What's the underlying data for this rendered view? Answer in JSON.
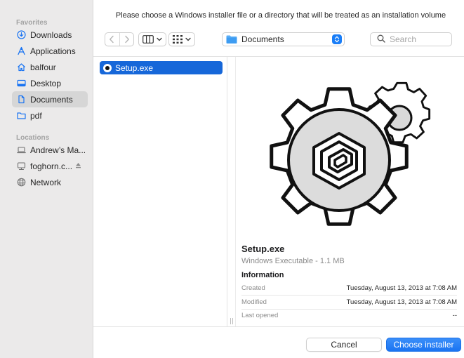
{
  "dialog": {
    "prompt": "Please choose a Windows installer file or a directory that will be treated as an installation volume"
  },
  "sidebar": {
    "favorites_header": "Favorites",
    "favorites": [
      {
        "label": "Downloads",
        "icon": "downloads-icon"
      },
      {
        "label": "Applications",
        "icon": "applications-icon"
      },
      {
        "label": "balfour",
        "icon": "home-icon"
      },
      {
        "label": "Desktop",
        "icon": "desktop-icon"
      },
      {
        "label": "Documents",
        "icon": "document-icon",
        "selected": true
      },
      {
        "label": "pdf",
        "icon": "folder-icon"
      }
    ],
    "locations_header": "Locations",
    "locations": [
      {
        "label": "Andrew’s Ma...",
        "icon": "laptop-icon"
      },
      {
        "label": "foghorn.c...",
        "icon": "network-drive-icon",
        "ejectable": true
      },
      {
        "label": "Network",
        "icon": "globe-icon"
      }
    ]
  },
  "toolbar": {
    "location": "Documents",
    "search_placeholder": "Search"
  },
  "files": [
    {
      "name": "Setup.exe",
      "selected": true
    }
  ],
  "preview": {
    "name": "Setup.exe",
    "kind": "Windows Executable - 1.1 MB",
    "info_header": "Information",
    "rows": [
      {
        "key": "Created",
        "value": "Tuesday, August 13, 2013 at 7:08 AM"
      },
      {
        "key": "Modified",
        "value": "Tuesday, August 13, 2013 at 7:08 AM"
      },
      {
        "key": "Last opened",
        "value": "--"
      }
    ]
  },
  "buttons": {
    "cancel": "Cancel",
    "confirm": "Choose installer"
  },
  "colors": {
    "accent": "#1a74f2",
    "selection": "#1667d9",
    "sidebar_bg": "#ebeaea"
  }
}
